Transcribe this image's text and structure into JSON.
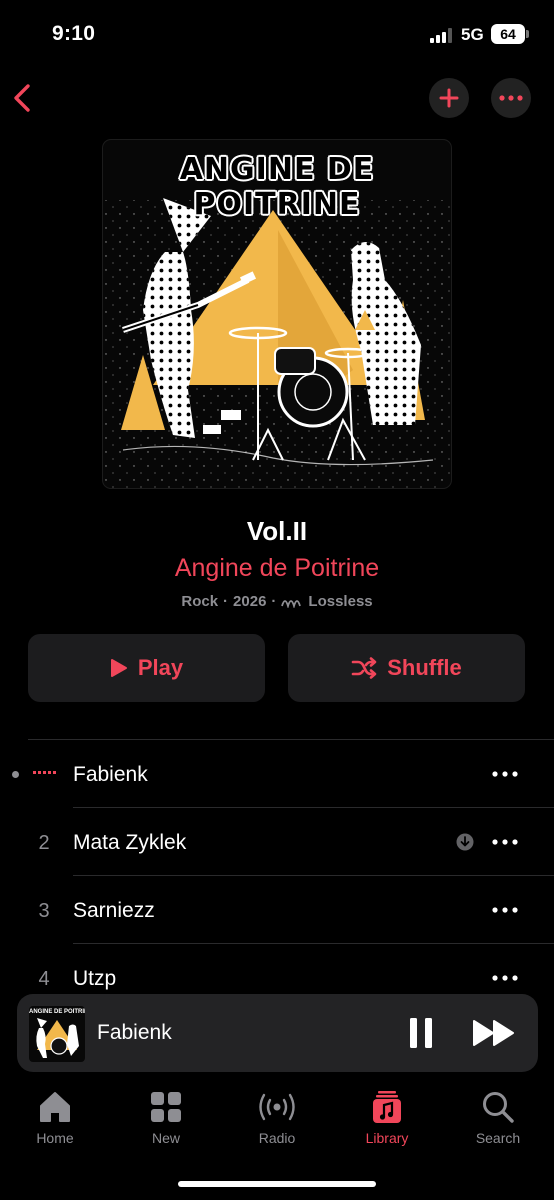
{
  "status": {
    "time": "9:10",
    "network": "5G",
    "battery": "64"
  },
  "album": {
    "artwork_text": "ANGINE DE POITRINE",
    "title": "Vol.II",
    "artist": "Angine de Poitrine",
    "genre": "Rock",
    "year": "2026",
    "quality": "Lossless",
    "sep": "·"
  },
  "actions": {
    "play_label": "Play",
    "shuffle_label": "Shuffle"
  },
  "tracks": [
    {
      "number": "",
      "title": "Fabienk",
      "playing": true
    },
    {
      "number": "2",
      "title": "Mata Zyklek",
      "downloaded": true
    },
    {
      "number": "3",
      "title": "Sarniezz"
    },
    {
      "number": "4",
      "title": "Utzp"
    }
  ],
  "mini_player": {
    "title": "Fabienk",
    "artwork_text": "ANGINE DE POITRINE"
  },
  "tabs": [
    {
      "label": "Home",
      "icon": "home-icon"
    },
    {
      "label": "New",
      "icon": "grid-icon"
    },
    {
      "label": "Radio",
      "icon": "radio-icon"
    },
    {
      "label": "Library",
      "icon": "library-icon",
      "active": true
    },
    {
      "label": "Search",
      "icon": "search-icon"
    }
  ],
  "colors": {
    "accent": "#f1465a",
    "background": "#000000",
    "surface": "#1c1c1e",
    "artwork_yellow": "#f2b84b"
  }
}
